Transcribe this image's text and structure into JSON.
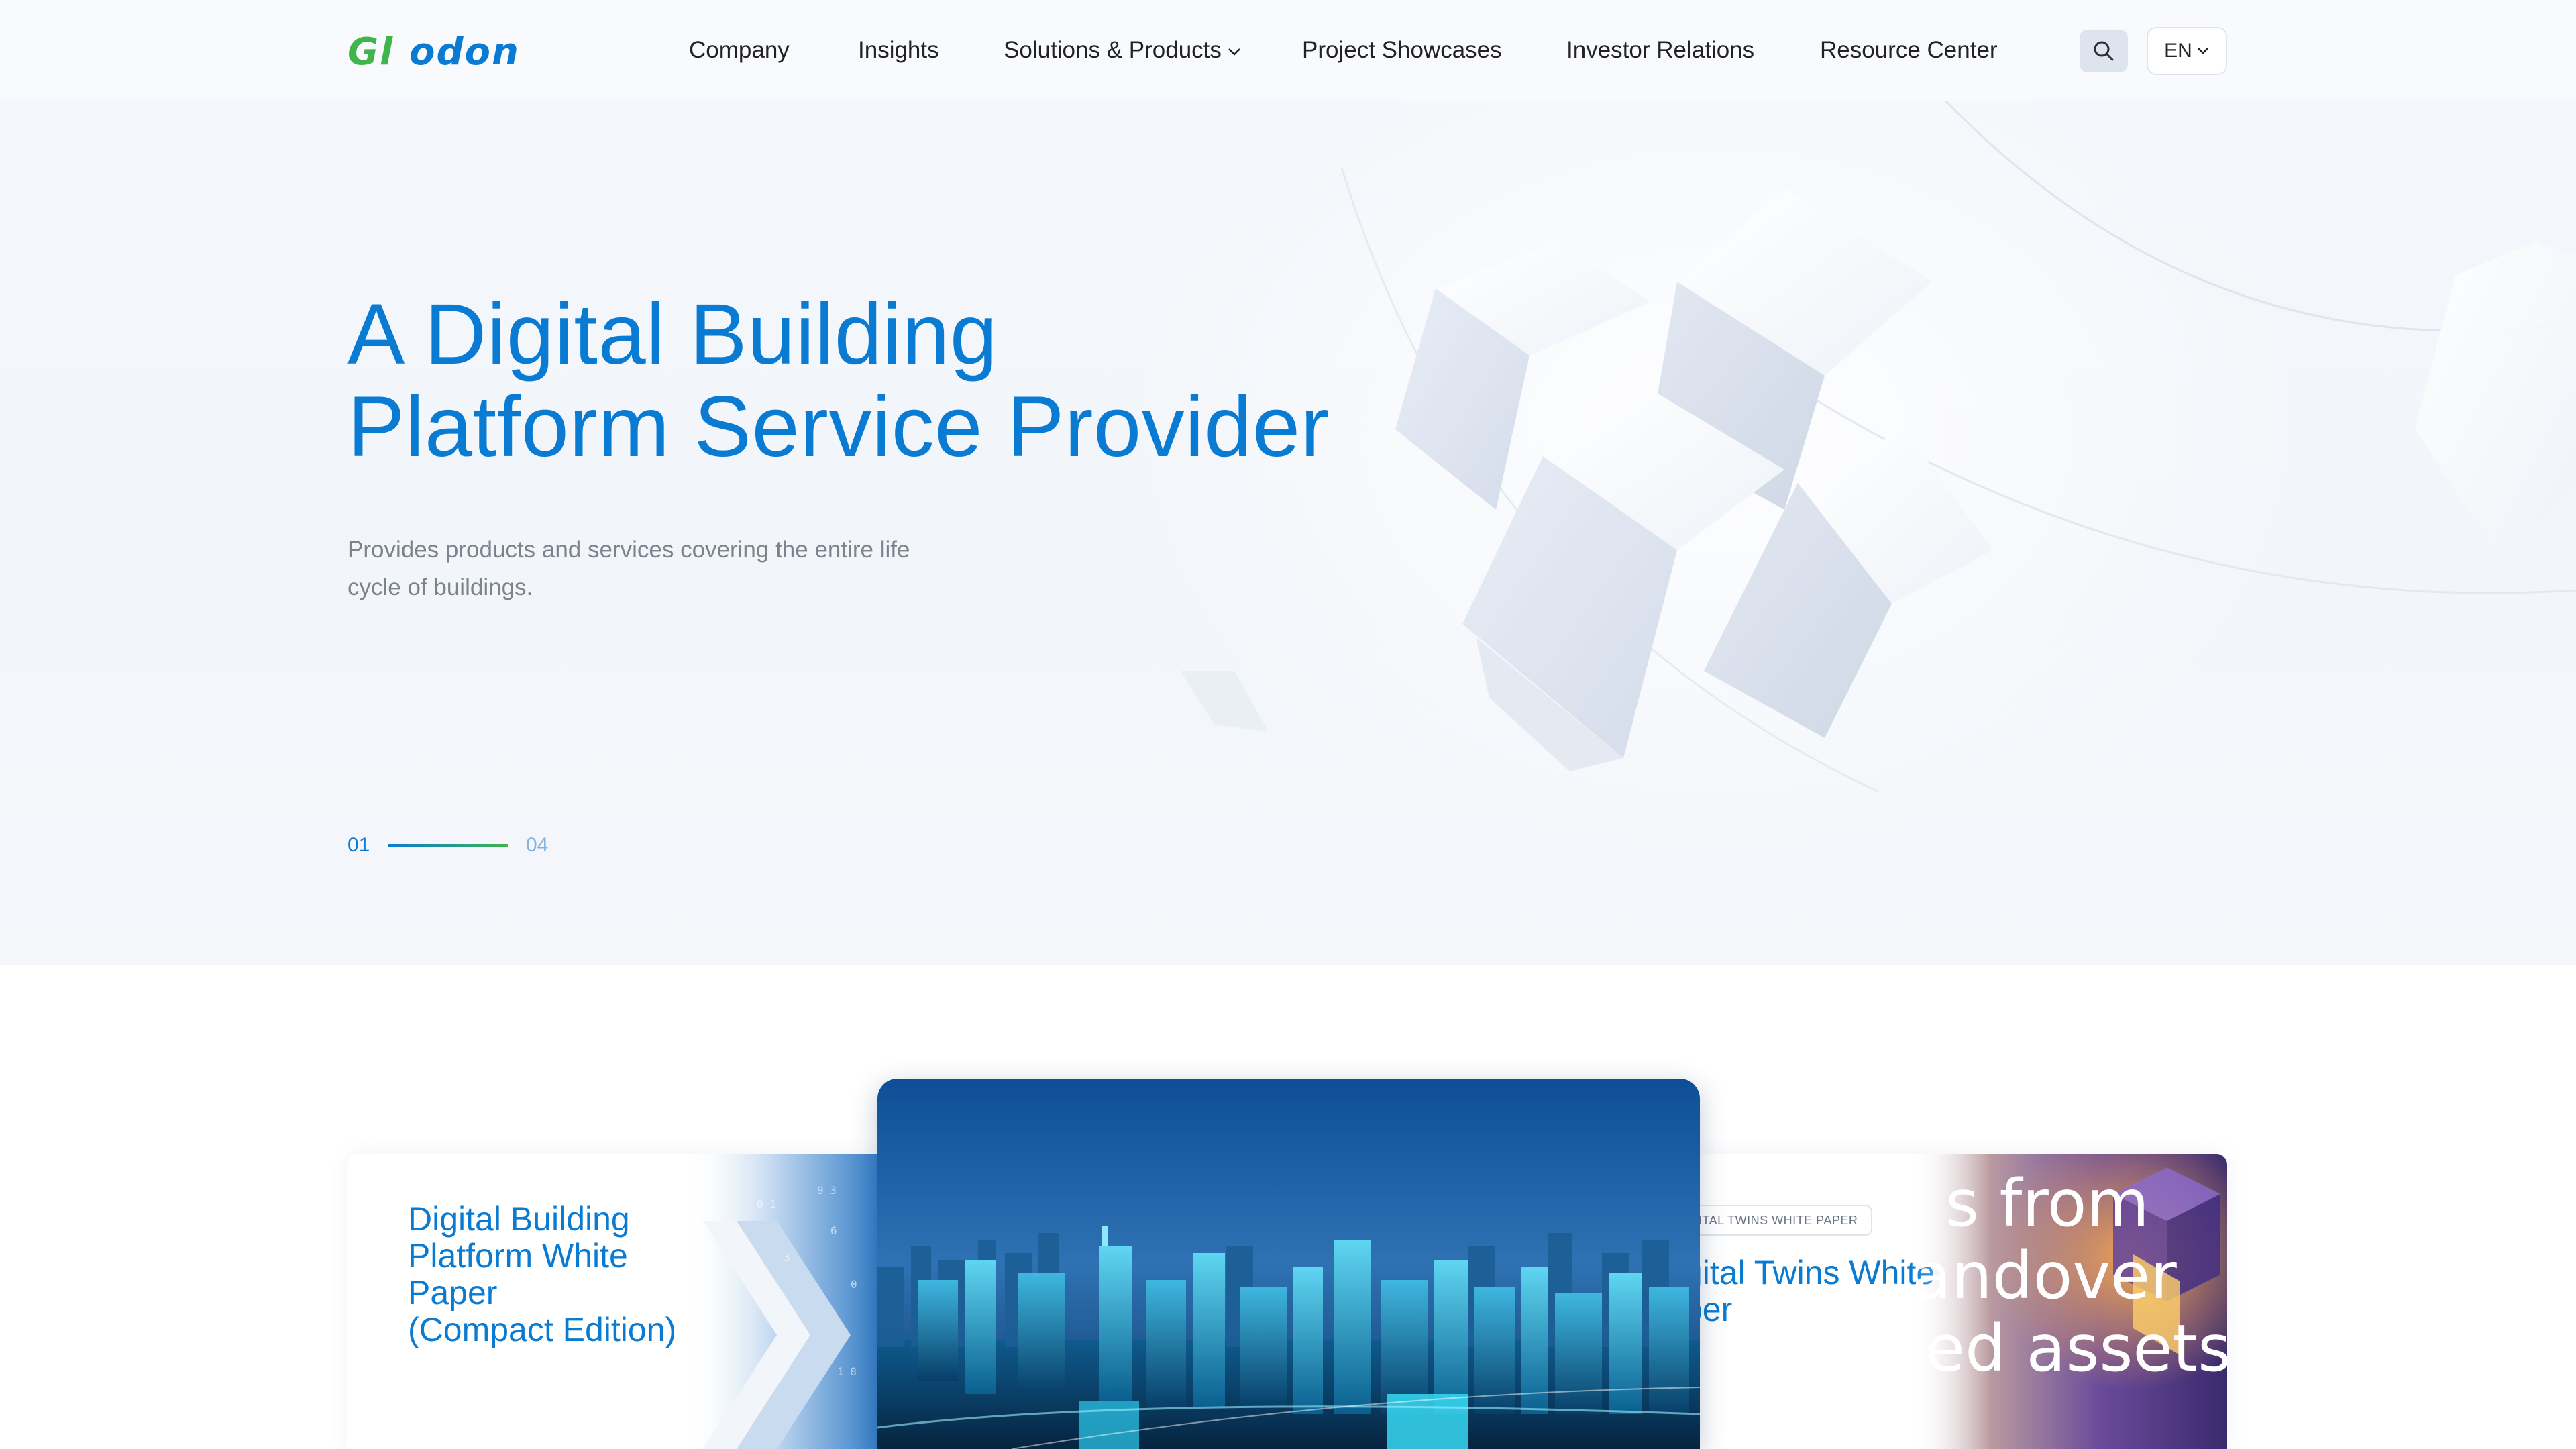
{
  "brand": {
    "logo_text": "Glodon",
    "logo_color_primary": "#3fb54a",
    "logo_color_accent": "#0a7bd3"
  },
  "nav": {
    "items": [
      {
        "label": "Company"
      },
      {
        "label": "Insights"
      },
      {
        "label": "Solutions & Products",
        "has_dropdown": true
      },
      {
        "label": "Project Showcases"
      },
      {
        "label": "Investor Relations"
      },
      {
        "label": "Resource Center"
      }
    ],
    "search_icon": "search-icon",
    "language": "EN"
  },
  "hero": {
    "title_line1": "A Digital Building",
    "title_line2": "Platform Service Provider",
    "subtitle_line1": "Provides products and services covering the entire life",
    "subtitle_line2": "cycle of buildings.",
    "slide_current": "01",
    "slide_total": "04"
  },
  "cards": {
    "left_title_lines": [
      "Digital Building",
      "Platform White",
      "Paper",
      "(Compact Edition)"
    ],
    "right_tag": "ITAL TWINS  WHITE PAPER",
    "right_title_lines": [
      "gital Twins White",
      "per"
    ],
    "right_art_lines": [
      "s from",
      "andover",
      "ed assets"
    ]
  },
  "colors": {
    "accent_blue": "#0a7bd3",
    "accent_green": "#3fb54a",
    "hero_bg": "#f3f6fa",
    "subtitle_gray": "#7c838c"
  }
}
